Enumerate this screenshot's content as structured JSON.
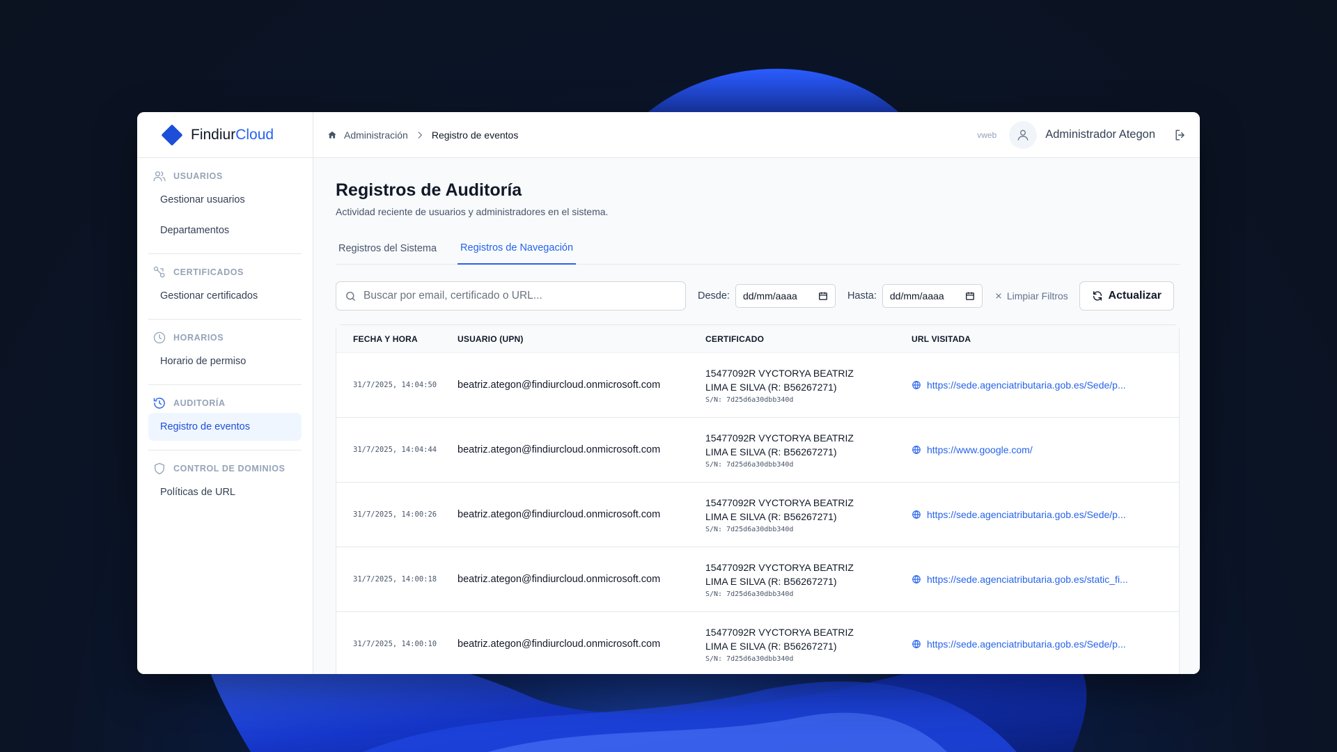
{
  "brand": {
    "name_part1": "Findiur",
    "name_part2": "Cloud"
  },
  "sidebar": {
    "sections": [
      {
        "title": "USUARIOS",
        "icon": "users-icon",
        "items": [
          {
            "label": "Gestionar usuarios",
            "active": false
          },
          {
            "label": "Departamentos",
            "active": false
          }
        ]
      },
      {
        "title": "CERTIFICADOS",
        "icon": "certificate-icon",
        "items": [
          {
            "label": "Gestionar certificados",
            "active": false
          }
        ]
      },
      {
        "title": "HORARIOS",
        "icon": "clock-icon",
        "items": [
          {
            "label": "Horario de permiso",
            "active": false
          }
        ]
      },
      {
        "title": "AUDITORÍA",
        "icon": "history-icon",
        "items": [
          {
            "label": "Registro de eventos",
            "active": true
          }
        ]
      },
      {
        "title": "CONTROL DE DOMINIOS",
        "icon": "shield-icon",
        "items": [
          {
            "label": "Políticas de URL",
            "active": false
          }
        ]
      }
    ]
  },
  "topbar": {
    "breadcrumb": {
      "parent": "Administración",
      "current": "Registro de eventos"
    },
    "version": "vweb",
    "user_name": "Administrador Ategon"
  },
  "page": {
    "title": "Registros de Auditoría",
    "subtitle": "Actividad reciente de usuarios y administradores en el sistema.",
    "tabs": [
      {
        "label": "Registros del Sistema",
        "active": false
      },
      {
        "label": "Registros de Navegación",
        "active": true
      }
    ]
  },
  "filters": {
    "search_placeholder": "Buscar por email, certificado o URL...",
    "from_label": "Desde:",
    "from_value": "dd/mm/aaaa",
    "to_label": "Hasta:",
    "to_value": "dd/mm/aaaa",
    "clear_label": "Limpiar Filtros",
    "refresh_label": "Actualizar"
  },
  "table": {
    "headers": {
      "date": "FECHA Y HORA",
      "user": "USUARIO (UPN)",
      "cert": "CERTIFICADO",
      "url": "URL VISITADA"
    },
    "rows": [
      {
        "date": "31/7/2025, 14:04:50",
        "user": "beatriz.ategon@findiurcloud.onmicrosoft.com",
        "cert_line1": "15477092R VYCTORYA BEATRIZ",
        "cert_line2": "LIMA E SILVA (R: B56267271)",
        "cert_sn": "S/N: 7d25d6a30dbb340d",
        "url": "https://sede.agenciatributaria.gob.es/Sede/p..."
      },
      {
        "date": "31/7/2025, 14:04:44",
        "user": "beatriz.ategon@findiurcloud.onmicrosoft.com",
        "cert_line1": "15477092R VYCTORYA BEATRIZ",
        "cert_line2": "LIMA E SILVA (R: B56267271)",
        "cert_sn": "S/N: 7d25d6a30dbb340d",
        "url": "https://www.google.com/"
      },
      {
        "date": "31/7/2025, 14:00:26",
        "user": "beatriz.ategon@findiurcloud.onmicrosoft.com",
        "cert_line1": "15477092R VYCTORYA BEATRIZ",
        "cert_line2": "LIMA E SILVA (R: B56267271)",
        "cert_sn": "S/N: 7d25d6a30dbb340d",
        "url": "https://sede.agenciatributaria.gob.es/Sede/p..."
      },
      {
        "date": "31/7/2025, 14:00:18",
        "user": "beatriz.ategon@findiurcloud.onmicrosoft.com",
        "cert_line1": "15477092R VYCTORYA BEATRIZ",
        "cert_line2": "LIMA E SILVA (R: B56267271)",
        "cert_sn": "S/N: 7d25d6a30dbb340d",
        "url": "https://sede.agenciatributaria.gob.es/static_fi..."
      },
      {
        "date": "31/7/2025, 14:00:10",
        "user": "beatriz.ategon@findiurcloud.onmicrosoft.com",
        "cert_line1": "15477092R VYCTORYA BEATRIZ",
        "cert_line2": "LIMA E SILVA (R: B56267271)",
        "cert_sn": "S/N: 7d25d6a30dbb340d",
        "url": "https://sede.agenciatributaria.gob.es/Sede/p..."
      }
    ]
  },
  "colors": {
    "accent": "#2563eb",
    "brand": "#1d4ed8",
    "background": "#0b1220"
  }
}
